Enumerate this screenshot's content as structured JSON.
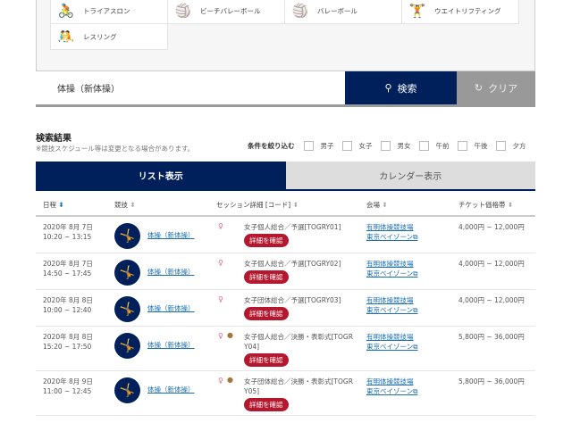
{
  "sports": [
    {
      "label": "トライアスロン",
      "icon": "triathlon-icon",
      "glyph": "🚴"
    },
    {
      "label": "ビーチバレーボール",
      "icon": "beach-volleyball-icon",
      "glyph": "🏐"
    },
    {
      "label": "バレーボール",
      "icon": "volleyball-icon",
      "glyph": "🏐"
    },
    {
      "label": "ウエイトリフティング",
      "icon": "weightlifting-icon",
      "glyph": "🏋"
    },
    {
      "label": "レスリング",
      "icon": "wrestling-icon",
      "glyph": "🤼"
    }
  ],
  "search": {
    "value": "体操（新体操）",
    "button": "検索",
    "clear": "クリア"
  },
  "results": {
    "title": "検索結果",
    "note": "※競技スケジュール等は変更となる場合があります。",
    "filter_label": "条件を絞り込む",
    "filters": [
      "男子",
      "女子",
      "男女",
      "午前",
      "午後",
      "夕方"
    ]
  },
  "tabs": {
    "list": "リスト表示",
    "calendar": "カレンダー表示"
  },
  "headers": {
    "date": "日程",
    "sport": "競技",
    "session": "セッション詳細 [コード]",
    "venue": "会場",
    "price": "チケット価格帯"
  },
  "detail_label": "詳細を確認",
  "rows": [
    {
      "date": "2020年 8月 7日",
      "time": "10:20 ~ 13:15",
      "sport": "体操（新体操）",
      "session": "女子個人総合／予選[TOGRY01]",
      "venue1": "有明体操競技場",
      "venue2": "東京ベイゾーン",
      "price": "4,000円 ~ 12,000円",
      "medal": false
    },
    {
      "date": "2020年 8月 7日",
      "time": "14:50 ~ 17:45",
      "sport": "体操（新体操）",
      "session": "女子個人総合／予選[TOGRY02]",
      "venue1": "有明体操競技場",
      "venue2": "東京ベイゾーン",
      "price": "4,000円 ~ 12,000円",
      "medal": false
    },
    {
      "date": "2020年 8月 8日",
      "time": "10:00 ~ 12:40",
      "sport": "体操（新体操）",
      "session": "女子団体総合／予選[TOGRY03]",
      "venue1": "有明体操競技場",
      "venue2": "東京ベイゾーン",
      "price": "4,000円 ~ 12,000円",
      "medal": false
    },
    {
      "date": "2020年 8月 8日",
      "time": "15:20 ~ 17:50",
      "sport": "体操（新体操）",
      "session": "女子個人総合／決勝・表彰式[TOGRY04]",
      "venue1": "有明体操競技場",
      "venue2": "東京ベイゾーン",
      "price": "5,800円 ~ 36,000円",
      "medal": true
    },
    {
      "date": "2020年 8月 9日",
      "time": "11:00 ~ 12:45",
      "sport": "体操（新体操）",
      "session": "女子団体総合／決勝・表彰式[TOGRY05]",
      "venue1": "有明体操競技場",
      "venue2": "東京ベイゾーン",
      "price": "5,800円 ~ 36,000円",
      "medal": true
    }
  ]
}
